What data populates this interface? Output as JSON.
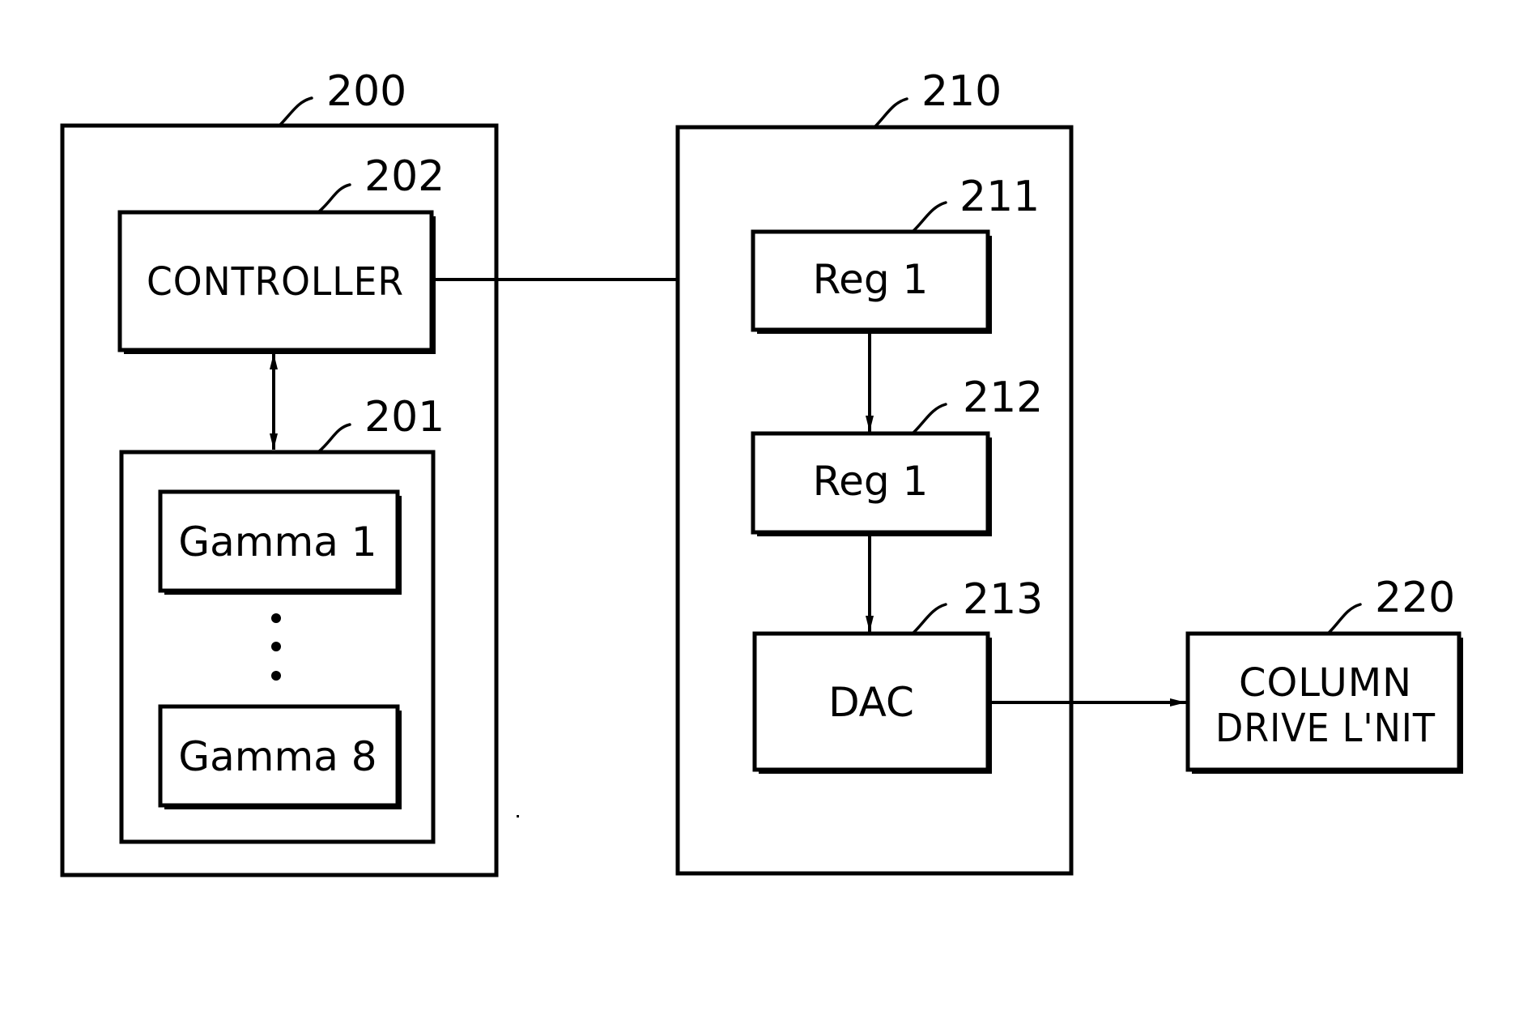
{
  "diagram": {
    "colors": {
      "ink": "#000000",
      "paper": "#ffffff"
    },
    "blocks": {
      "outer_left": {
        "ref": "200"
      },
      "controller": {
        "ref": "202",
        "label": "CONTROLLER"
      },
      "gamma_group": {
        "ref": "201"
      },
      "gamma_first": {
        "label": "Gamma 1"
      },
      "gamma_last": {
        "label": "Gamma 8"
      },
      "outer_mid": {
        "ref": "210"
      },
      "reg_a": {
        "ref": "211",
        "label": "Reg 1"
      },
      "reg_b": {
        "ref": "212",
        "label": "Reg 1"
      },
      "dac": {
        "ref": "213",
        "label": "DAC"
      },
      "column_drive": {
        "ref": "220",
        "label_line1": "COLUMN",
        "label_line2": "DRIVE L'NIT"
      }
    },
    "connections": [
      {
        "from": "CONTROLLER",
        "to": "Reg 1 (211)",
        "type": "arrow"
      },
      {
        "from": "CONTROLLER",
        "to": "Gamma group (201)",
        "type": "bidirectional-arrow"
      },
      {
        "from": "Reg 1 (211)",
        "to": "Reg 1 (212)",
        "type": "arrow"
      },
      {
        "from": "Reg 1 (212)",
        "to": "DAC (213)",
        "type": "arrow"
      },
      {
        "from": "DAC (213)",
        "to": "COLUMN DRIVE UNIT (220)",
        "type": "arrow"
      }
    ],
    "ellipsis_dots": 3
  }
}
